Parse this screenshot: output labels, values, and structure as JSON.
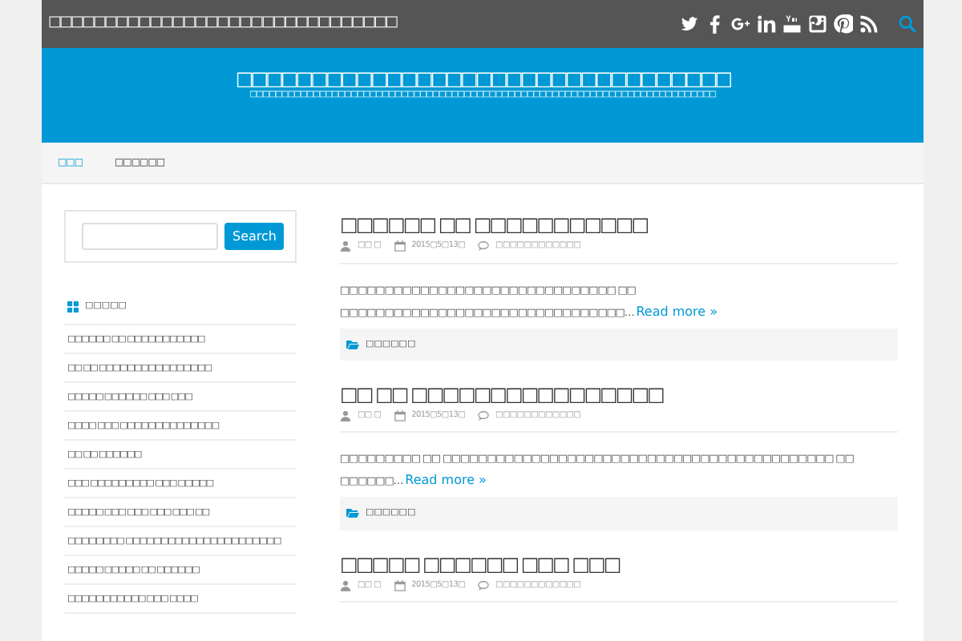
{
  "topbar": {
    "site_title": "□□□□□□□□□□□□□□□□□□□□□□□□□□□□□□□",
    "social": [
      {
        "kind": "twitter"
      },
      {
        "kind": "facebook"
      },
      {
        "kind": "googleplus"
      },
      {
        "kind": "linkedin"
      },
      {
        "kind": "youtube"
      },
      {
        "kind": "instagram"
      },
      {
        "kind": "pinterest"
      },
      {
        "kind": "rss"
      }
    ]
  },
  "header": {
    "title": "□□□□□□□□□□□□□□□□□□□□□□□□□□□□□□□□□",
    "tagline": "□□□□□□□□□□□□□□□□□□□□□□□□□□□□□□□□□□□□□□□□□□□□□□□□□□□□□□□□□□□□□□□□□□□□□□□□□□"
  },
  "nav": [
    {
      "label": "□□□",
      "selected": true
    },
    {
      "label": "□□□□□□",
      "selected": false
    }
  ],
  "sidebar": {
    "search_button": "Search",
    "widget_title": "□□□□□",
    "items": [
      "□□□□□□ □□ □□□□□□□□□□□",
      "□□ □□ □□□□□□□□□□□□□□□□",
      "□□□□□ □□□□□□ □□□ □□□",
      "□□□□ □□□ □□□□□□□□□□□□□□",
      "□□ □□ □□□□□□",
      "□□□ □□□□□□□□□ □□□ □□□□□",
      "□□□□□ □□□ □□□ □□□ □□□ □□",
      "□□□□□□□□ □□□□□□□□□□□□□□□□□□□□□□",
      "□□□□□ □□□□□ □□ □□□□□□",
      "□□□□□□□□□□□ □□□ □□□□"
    ]
  },
  "posts": [
    {
      "title": "□□□□□□ □□ □□□□□□□□□□□",
      "author": "□□ □",
      "date": "2015□5□13□",
      "comments": "□□□□□□□□□□□□",
      "excerpt": "□□□□□□□□□□□□□□□□□□□□□□□□□□□□□□□ □□ □□□□□□□□□□□□□□□□□□□□□□□□□□□□□□□□…",
      "read_more": "Read more »",
      "category": "□□□□□□"
    },
    {
      "title": "□□ □□ □□□□□□□□□□□□□□□□",
      "author": "□□ □",
      "date": "2015□5□13□",
      "comments": "□□□□□□□□□□□□",
      "excerpt": "□□□□□□□□□ □□ □□□□□□□□□□□□□□□□□□□□□□□□□□□□□□□□□□□□□□□□□□□□ □□ □□□□□□…",
      "read_more": "Read more »",
      "category": "□□□□□□"
    },
    {
      "title": "□□□□□ □□□□□□ □□□ □□□",
      "author": "□□ □",
      "date": "2015□5□13□",
      "comments": "□□□□□□□□□□□□"
    }
  ]
}
